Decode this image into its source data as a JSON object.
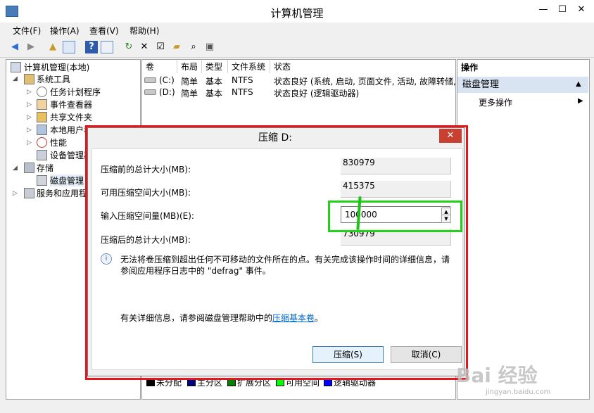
{
  "window": {
    "title": "计算机管理"
  },
  "window_buttons": {
    "minimize": "—",
    "maximize": "☐",
    "close": "✕"
  },
  "menu": [
    "文件(F)",
    "操作(A)",
    "查看(V)",
    "帮助(H)"
  ],
  "toolbar_icons": [
    "back-arrow-icon",
    "forward-arrow-icon",
    "up-folder-icon",
    "show-tree-icon",
    "help-icon",
    "properties-icon",
    "refresh-icon",
    "delete-icon",
    "checklist-icon",
    "open-folder-icon",
    "search-icon",
    "disk-icon"
  ],
  "tree": [
    {
      "label": "计算机管理(本地)"
    },
    {
      "label": "系统工具"
    },
    {
      "label": "任务计划程序"
    },
    {
      "label": "事件查看器"
    },
    {
      "label": "共享文件夹"
    },
    {
      "label": "本地用户和组"
    },
    {
      "label": "性能"
    },
    {
      "label": "设备管理器"
    },
    {
      "label": "存储"
    },
    {
      "label": "磁盘管理"
    },
    {
      "label": "服务和应用程序"
    }
  ],
  "volumes_table": {
    "headers": [
      "卷",
      "布局",
      "类型",
      "文件系统",
      "状态"
    ],
    "rows": [
      {
        "volume": "(C:)",
        "layout": "简单",
        "type": "基本",
        "fs": "NTFS",
        "status": "状态良好 (系统, 启动, 页面文件, 活动, 故障转储,"
      },
      {
        "volume": "(D:)",
        "layout": "简单",
        "type": "基本",
        "fs": "NTFS",
        "status": "状态良好 (逻辑驱动器)"
      }
    ]
  },
  "actions": {
    "header": "操作",
    "section": "磁盘管理",
    "more": "更多操作"
  },
  "legend": [
    {
      "label": "未分配",
      "color": "#000000"
    },
    {
      "label": "主分区",
      "color": "#000080"
    },
    {
      "label": "扩展分区",
      "color": "#008000"
    },
    {
      "label": "可用空间",
      "color": "#00ff00"
    },
    {
      "label": "逻辑驱动器",
      "color": "#0000ff"
    }
  ],
  "dialog": {
    "title": "压缩 D:",
    "total_before_label": "压缩前的总计大小(MB):",
    "total_before_value": "830979",
    "available_label": "可用压缩空间大小(MB):",
    "available_value": "415375",
    "input_label": "输入压缩空间量(MB)(E):",
    "input_value": "100000",
    "total_after_label": "压缩后的总计大小(MB):",
    "total_after_value": "730979",
    "info_line1": "无法将卷压缩到超出任何不可移动的文件所在的点。有关完成该操作时间的详细信息，请",
    "info_line2": "参阅应用程序日志中的 \"defrag\" 事件。",
    "help_prefix": "有关详细信息，请参阅磁盘管理帮助中的",
    "help_link": "压缩基本卷",
    "help_suffix": "。",
    "shrink_button": "压缩(S)",
    "cancel_button": "取消(C)"
  },
  "watermark": {
    "text": "Bai 经验",
    "url": "jingyan.baidu.com"
  }
}
